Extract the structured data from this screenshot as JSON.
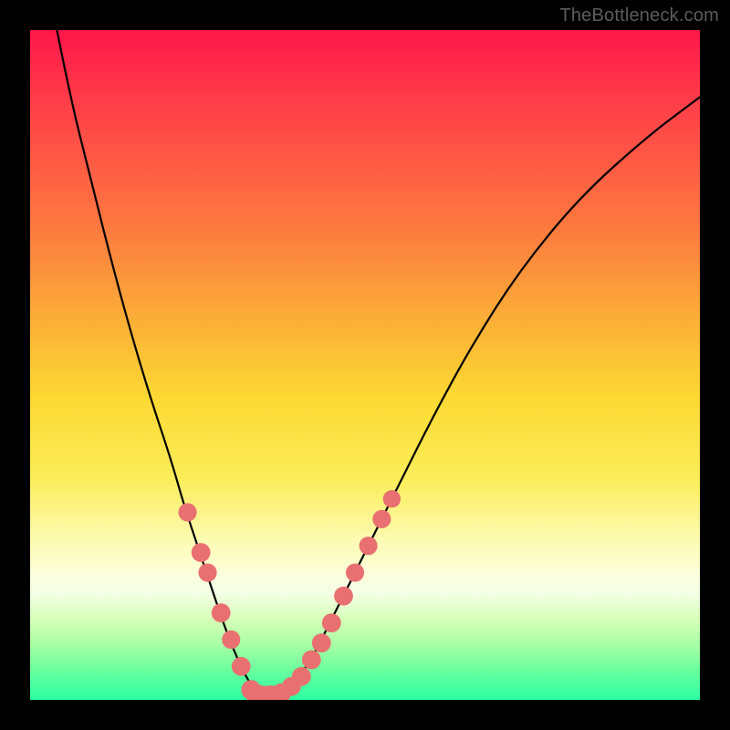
{
  "watermark": "TheBottleneck.com",
  "colors": {
    "frame": "#000000",
    "curve": "#000000",
    "markers": "#e97070",
    "gradient_top": "#ff1649",
    "gradient_bottom": "#2cffa3"
  },
  "chart_data": {
    "type": "line",
    "title": "",
    "xlabel": "",
    "ylabel": "",
    "xlim": [
      0,
      100
    ],
    "ylim": [
      0,
      100
    ],
    "curve": {
      "description": "V-shaped bottleneck curve; x is normalized 0-100, y is 0 at top (worst) to 100 at bottom (best).",
      "points": [
        {
          "x": 4,
          "y": 0
        },
        {
          "x": 6,
          "y": 10
        },
        {
          "x": 9,
          "y": 22
        },
        {
          "x": 12,
          "y": 34
        },
        {
          "x": 15,
          "y": 45
        },
        {
          "x": 18,
          "y": 55
        },
        {
          "x": 21,
          "y": 64
        },
        {
          "x": 23,
          "y": 71
        },
        {
          "x": 25,
          "y": 77
        },
        {
          "x": 27,
          "y": 83
        },
        {
          "x": 29,
          "y": 89
        },
        {
          "x": 31,
          "y": 94
        },
        {
          "x": 33,
          "y": 98
        },
        {
          "x": 35,
          "y": 99.5
        },
        {
          "x": 37,
          "y": 99.5
        },
        {
          "x": 39,
          "y": 98
        },
        {
          "x": 42,
          "y": 94
        },
        {
          "x": 45,
          "y": 88
        },
        {
          "x": 48,
          "y": 82
        },
        {
          "x": 51,
          "y": 76
        },
        {
          "x": 55,
          "y": 68
        },
        {
          "x": 60,
          "y": 58
        },
        {
          "x": 66,
          "y": 47
        },
        {
          "x": 73,
          "y": 36
        },
        {
          "x": 82,
          "y": 25
        },
        {
          "x": 92,
          "y": 16
        },
        {
          "x": 100,
          "y": 10
        }
      ]
    },
    "markers": {
      "description": "Salmon marker points along the lower portion of the curve (approximate positions).",
      "points": [
        {
          "x": 23.5,
          "y": 72,
          "r": 1.1
        },
        {
          "x": 25.5,
          "y": 78,
          "r": 1.2
        },
        {
          "x": 26.5,
          "y": 81,
          "r": 1.1
        },
        {
          "x": 28.5,
          "y": 87,
          "r": 1.2
        },
        {
          "x": 30.0,
          "y": 91,
          "r": 1.1
        },
        {
          "x": 31.5,
          "y": 95,
          "r": 1.2
        },
        {
          "x": 33.0,
          "y": 98.5,
          "r": 1.3
        },
        {
          "x": 34.5,
          "y": 99.3,
          "r": 1.3
        },
        {
          "x": 36.0,
          "y": 99.3,
          "r": 1.3
        },
        {
          "x": 37.5,
          "y": 99.0,
          "r": 1.3
        },
        {
          "x": 39.0,
          "y": 98.0,
          "r": 1.2
        },
        {
          "x": 40.5,
          "y": 96.5,
          "r": 1.2
        },
        {
          "x": 42.0,
          "y": 94.0,
          "r": 1.2
        },
        {
          "x": 43.5,
          "y": 91.5,
          "r": 1.2
        },
        {
          "x": 45.0,
          "y": 88.5,
          "r": 1.2
        },
        {
          "x": 46.8,
          "y": 84.5,
          "r": 1.2
        },
        {
          "x": 48.5,
          "y": 81.0,
          "r": 1.1
        },
        {
          "x": 50.5,
          "y": 77.0,
          "r": 1.1
        },
        {
          "x": 52.5,
          "y": 73.0,
          "r": 1.1
        },
        {
          "x": 54.0,
          "y": 70.0,
          "r": 1.0
        }
      ]
    }
  }
}
